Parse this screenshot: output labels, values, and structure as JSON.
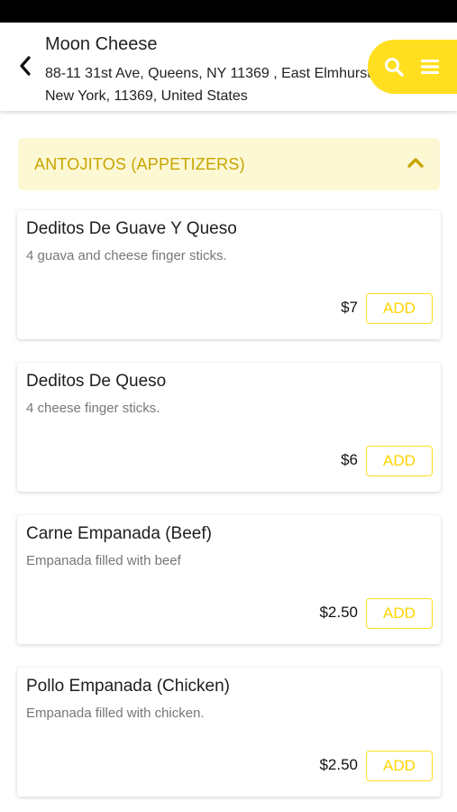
{
  "header": {
    "title": "Moon Cheese",
    "address_line1": "88-11 31st Ave, Queens, NY 11369 , East Elmhurst",
    "address_line2": "New York, 11369, United States"
  },
  "icons": {
    "back": "chevron-left-icon",
    "search": "search-icon",
    "menu": "hamburger-menu-icon",
    "collapse": "chevron-up-icon"
  },
  "colors": {
    "accent": "#ffdf1f",
    "category_bg": "#fdf8d4",
    "category_text": "#c7a500"
  },
  "category": {
    "title": "ANTOJITOS (APPETIZERS)"
  },
  "items": [
    {
      "name": "Deditos De Guave Y Queso",
      "description": "4 guava and cheese finger sticks.",
      "price": "$7",
      "add_label": "ADD"
    },
    {
      "name": "Deditos De Queso",
      "description": "4 cheese finger sticks.",
      "price": "$6",
      "add_label": "ADD"
    },
    {
      "name": "Carne Empanada (Beef)",
      "description": "Empanada filled with beef",
      "price": "$2.50",
      "add_label": "ADD"
    },
    {
      "name": "Pollo Empanada (Chicken)",
      "description": "Empanada filled with chicken.",
      "price": "$2.50",
      "add_label": "ADD"
    }
  ]
}
